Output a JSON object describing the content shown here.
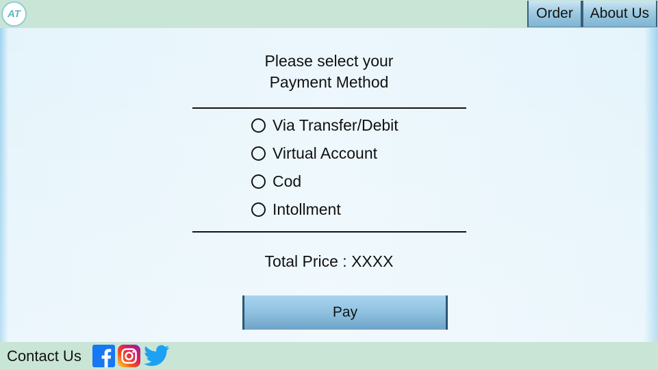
{
  "header": {
    "logo_text": "AT",
    "nav": {
      "order_label": "Order",
      "about_label": "About Us"
    }
  },
  "main": {
    "heading_line1": "Please select your",
    "heading_line2": "Payment Method",
    "payment_options": [
      {
        "label": "Via Transfer/Debit",
        "selected": false
      },
      {
        "label": "Virtual Account",
        "selected": false
      },
      {
        "label": "Cod",
        "selected": false
      },
      {
        "label": "Intollment",
        "selected": false
      }
    ],
    "total_price": "Total Price : XXXX",
    "pay_label": "Pay"
  },
  "footer": {
    "contact_label": "Contact Us",
    "social_icons": [
      "facebook-icon",
      "instagram-icon",
      "twitter-icon"
    ]
  },
  "colors": {
    "bar_background": "#c9e5d6",
    "button_blue": "#8fc1e0",
    "button_border": "#2e5673",
    "content_background": "#ecf7fd",
    "facebook": "#1877f2",
    "twitter": "#1da1f2"
  }
}
